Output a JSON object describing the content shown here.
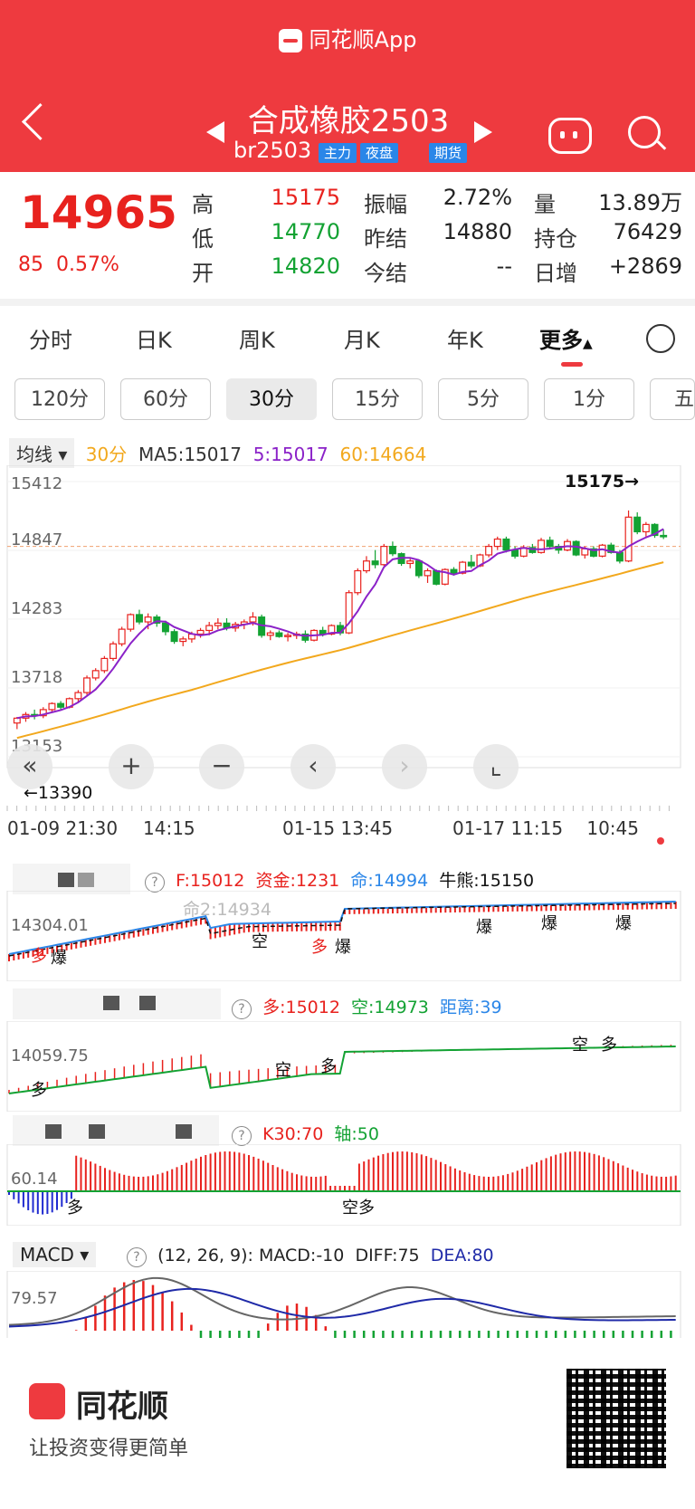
{
  "app": {
    "title": "同花顺App"
  },
  "header": {
    "name": "合成橡胶2503",
    "code": "br2503",
    "tags": [
      "主力",
      "夜盘",
      "期货"
    ]
  },
  "quote": {
    "price": "14965",
    "change": "85",
    "change_pct": "0.57%",
    "labels": {
      "high": "高",
      "low": "低",
      "open": "开",
      "amplitude": "振幅",
      "prev_settle": "昨结",
      "settle": "今结",
      "volume": "量",
      "open_interest": "持仓",
      "daily_add": "日增"
    },
    "high": "15175",
    "low": "14770",
    "open": "14820",
    "amplitude": "2.72%",
    "prev_settle": "14880",
    "settle": "--",
    "volume": "13.89万",
    "open_interest": "76429",
    "daily_add": "+2869"
  },
  "tabs": [
    "分时",
    "日K",
    "周K",
    "月K",
    "年K",
    "更多"
  ],
  "periods": [
    "120分",
    "60分",
    "30分",
    "15分",
    "5分",
    "1分",
    "五"
  ],
  "ma_bar": {
    "selector": "均线",
    "period": "30分",
    "ma5": "MA5:15017",
    "ma5_short": "5:15017",
    "ma60": "60:14664"
  },
  "chart_data": {
    "type": "candlestick",
    "y_ticks": [
      "15412",
      "14847",
      "14283",
      "13718",
      "13153"
    ],
    "x_ticks": [
      "01-09 21:30",
      "14:15",
      "01-15 13:45",
      "01-17 11:15",
      "10:45"
    ],
    "high_label": "15175→",
    "low_label": "←13390",
    "reference_line": 14880,
    "ylim": [
      13153,
      15412
    ],
    "candles": [
      [
        13430,
        13480,
        13380,
        13470
      ],
      [
        13470,
        13520,
        13440,
        13500
      ],
      [
        13500,
        13540,
        13460,
        13490
      ],
      [
        13490,
        13560,
        13470,
        13540
      ],
      [
        13540,
        13600,
        13520,
        13590
      ],
      [
        13590,
        13610,
        13540,
        13560
      ],
      [
        13560,
        13640,
        13550,
        13630
      ],
      [
        13630,
        13700,
        13600,
        13680
      ],
      [
        13680,
        13820,
        13660,
        13800
      ],
      [
        13800,
        13880,
        13780,
        13860
      ],
      [
        13860,
        13980,
        13840,
        13960
      ],
      [
        13960,
        14100,
        13940,
        14080
      ],
      [
        14080,
        14220,
        14060,
        14200
      ],
      [
        14200,
        14330,
        14180,
        14320
      ],
      [
        14320,
        14360,
        14240,
        14260
      ],
      [
        14260,
        14330,
        14200,
        14300
      ],
      [
        14300,
        14320,
        14220,
        14250
      ],
      [
        14250,
        14270,
        14150,
        14180
      ],
      [
        14180,
        14200,
        14080,
        14100
      ],
      [
        14100,
        14140,
        14060,
        14120
      ],
      [
        14120,
        14180,
        14090,
        14160
      ],
      [
        14160,
        14210,
        14130,
        14190
      ],
      [
        14190,
        14260,
        14150,
        14230
      ],
      [
        14230,
        14290,
        14200,
        14250
      ],
      [
        14250,
        14290,
        14190,
        14210
      ],
      [
        14210,
        14260,
        14180,
        14240
      ],
      [
        14240,
        14280,
        14200,
        14260
      ],
      [
        14260,
        14340,
        14230,
        14300
      ],
      [
        14300,
        14320,
        14130,
        14150
      ],
      [
        14150,
        14190,
        14110,
        14170
      ],
      [
        14170,
        14190,
        14130,
        14140
      ],
      [
        14140,
        14170,
        14100,
        14150
      ],
      [
        14150,
        14180,
        14120,
        14160
      ],
      [
        14160,
        14190,
        14090,
        14110
      ],
      [
        14110,
        14200,
        14100,
        14190
      ],
      [
        14190,
        14220,
        14140,
        14160
      ],
      [
        14160,
        14240,
        14150,
        14230
      ],
      [
        14230,
        14260,
        14150,
        14170
      ],
      [
        14170,
        14520,
        14160,
        14500
      ],
      [
        14500,
        14700,
        14480,
        14680
      ],
      [
        14680,
        14800,
        14660,
        14760
      ],
      [
        14760,
        14850,
        14700,
        14730
      ],
      [
        14730,
        14900,
        14720,
        14880
      ],
      [
        14880,
        14920,
        14800,
        14820
      ],
      [
        14820,
        14830,
        14720,
        14740
      ],
      [
        14740,
        14780,
        14700,
        14760
      ],
      [
        14760,
        14770,
        14620,
        14640
      ],
      [
        14640,
        14700,
        14580,
        14680
      ],
      [
        14680,
        14690,
        14560,
        14570
      ],
      [
        14570,
        14700,
        14560,
        14690
      ],
      [
        14690,
        14710,
        14640,
        14660
      ],
      [
        14660,
        14760,
        14650,
        14750
      ],
      [
        14750,
        14810,
        14700,
        14720
      ],
      [
        14720,
        14820,
        14710,
        14810
      ],
      [
        14810,
        14900,
        14790,
        14880
      ],
      [
        14880,
        14960,
        14850,
        14940
      ],
      [
        14940,
        14960,
        14830,
        14850
      ],
      [
        14850,
        14880,
        14780,
        14800
      ],
      [
        14800,
        14890,
        14790,
        14870
      ],
      [
        14870,
        14900,
        14820,
        14830
      ],
      [
        14830,
        14950,
        14820,
        14930
      ],
      [
        14930,
        14960,
        14860,
        14880
      ],
      [
        14880,
        14900,
        14820,
        14850
      ],
      [
        14850,
        14940,
        14840,
        14920
      ],
      [
        14920,
        14930,
        14800,
        14810
      ],
      [
        14810,
        14880,
        14780,
        14860
      ],
      [
        14860,
        14880,
        14790,
        14800
      ],
      [
        14800,
        14900,
        14790,
        14890
      ],
      [
        14890,
        14910,
        14820,
        14830
      ],
      [
        14830,
        14850,
        14740,
        14760
      ],
      [
        14760,
        15175,
        14750,
        15120
      ],
      [
        15120,
        15160,
        14980,
        15000
      ],
      [
        15000,
        15080,
        14960,
        15060
      ],
      [
        15060,
        15070,
        14950,
        14970
      ],
      [
        14970,
        15020,
        14940,
        14965
      ]
    ]
  },
  "panels": {
    "p1": {
      "f": "F:15012",
      "fund": "资金:1231",
      "ming": "命:14994",
      "bull_bear": "牛熊:15150",
      "ming2": "命2:14934",
      "ytick": "14304.01",
      "marks": [
        "多",
        "爆",
        "空",
        "多",
        "爆",
        "爆",
        "爆",
        "爆"
      ]
    },
    "p2": {
      "duo": "多:15012",
      "kong": "空:14973",
      "dist": "距离:39",
      "ytick": "14059.75",
      "marks": [
        "多",
        "空",
        "多",
        "空",
        "多"
      ]
    },
    "p3": {
      "k30": "K30:70",
      "axis": "轴:50",
      "ytick": "60.14",
      "marks": [
        "多",
        "空多"
      ]
    },
    "macd": {
      "selector": "MACD",
      "params": "(12, 26, 9):",
      "macd": "MACD:-10",
      "diff": "DIFF:75",
      "dea": "DEA:80",
      "ytick": "79.57"
    }
  },
  "footer": {
    "brand": "同花顺",
    "slogan": "让投资变得更简单"
  },
  "colors": {
    "accent": "#ee3a3f",
    "up": "#e8221e",
    "down": "#13a233",
    "ma5": "#8b22c8",
    "ma60": "#f2a81d",
    "blue": "#2a86e8"
  }
}
